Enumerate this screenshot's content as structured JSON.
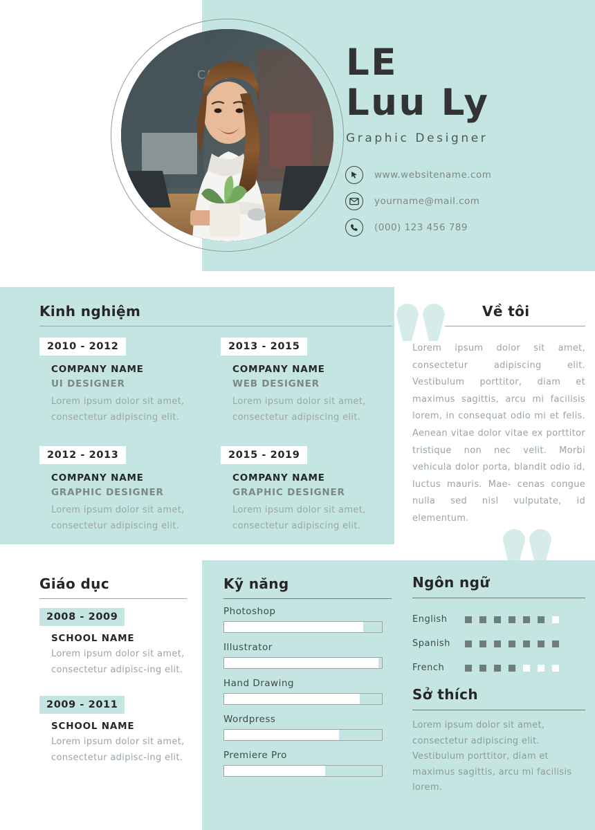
{
  "theme": {
    "panel_teal": "#c5e5e2",
    "quote_teal": "#d6ecea",
    "dark_text": "#262626",
    "muted_text": "#9aa5a6",
    "white": "#ffffff"
  },
  "header": {
    "name_line1": "LE",
    "name_line2": "Luu Ly",
    "job_title": "Graphic Designer",
    "contacts": [
      {
        "icon": "cursor-icon",
        "text": "www.websitename.com"
      },
      {
        "icon": "envelope-icon",
        "text": "yourname@mail.com"
      },
      {
        "icon": "phone-icon",
        "text": "(000) 123 456 789"
      }
    ]
  },
  "experience": {
    "title": "Kinh nghiệm",
    "items": [
      {
        "date": "2010 - 2012",
        "company": "COMPANY NAME",
        "role": "UI DESIGNER",
        "desc": "Lorem ipsum dolor sit amet, consectetur adipiscing elit."
      },
      {
        "date": "2012 - 2013",
        "company": "COMPANY NAME",
        "role": "GRAPHIC DESIGNER",
        "desc": "Lorem ipsum dolor sit amet, consectetur adipiscing elit."
      },
      {
        "date": "2013 - 2015",
        "company": "COMPANY NAME",
        "role": "WEB DESIGNER",
        "desc": "Lorem ipsum dolor sit amet, consectetur adipiscing elit."
      },
      {
        "date": "2015 - 2019",
        "company": "COMPANY NAME",
        "role": "GRAPHIC DESIGNER",
        "desc": "Lorem ipsum dolor sit amet, consectetur adipiscing elit."
      }
    ]
  },
  "about": {
    "title": "Về tôi",
    "text": "Lorem ipsum dolor sit amet, consectetur adipiscing elit. Vestibulum porttitor, diam et maximus sagittis, arcu mi facilisis lorem, in consequat odio mi et felis. Aenean vitae dolor vitae ex porttitor tristique non nec velit. Morbi vehicula dolor porta, blandit odio id, luctus mauris. Mae- cenas congue nulla sed nisl vulputate, id elementum."
  },
  "education": {
    "title": "Giáo dục",
    "items": [
      {
        "date": "2008 - 2009",
        "school": "SCHOOL NAME",
        "desc": "Lorem ipsum dolor sit amet, consectetur adipisc-ing elit."
      },
      {
        "date": "2009 - 2011",
        "school": "SCHOOL NAME",
        "desc": "Lorem ipsum dolor sit amet, consectetur adipisc-ing elit."
      }
    ]
  },
  "skills": {
    "title": "Kỹ năng",
    "items": [
      {
        "label": "Photoshop",
        "percent": 88
      },
      {
        "label": "Illustrator",
        "percent": 98
      },
      {
        "label": "Hand Drawing",
        "percent": 86
      },
      {
        "label": "Wordpress",
        "percent": 73
      },
      {
        "label": "Premiere Pro",
        "percent": 64
      }
    ]
  },
  "languages": {
    "title": "Ngôn ngữ",
    "total_dots": 7,
    "items": [
      {
        "name": "English",
        "filled": 6
      },
      {
        "name": "Spanish",
        "filled": 7
      },
      {
        "name": "French",
        "filled": 4
      }
    ]
  },
  "hobbies": {
    "title": "Sở thích",
    "text": "Lorem ipsum dolor sit amet, consectetur adipiscing elit. Vestibulum porttitor, diam et maximus sagittis, arcu mi facilisis lorem."
  }
}
